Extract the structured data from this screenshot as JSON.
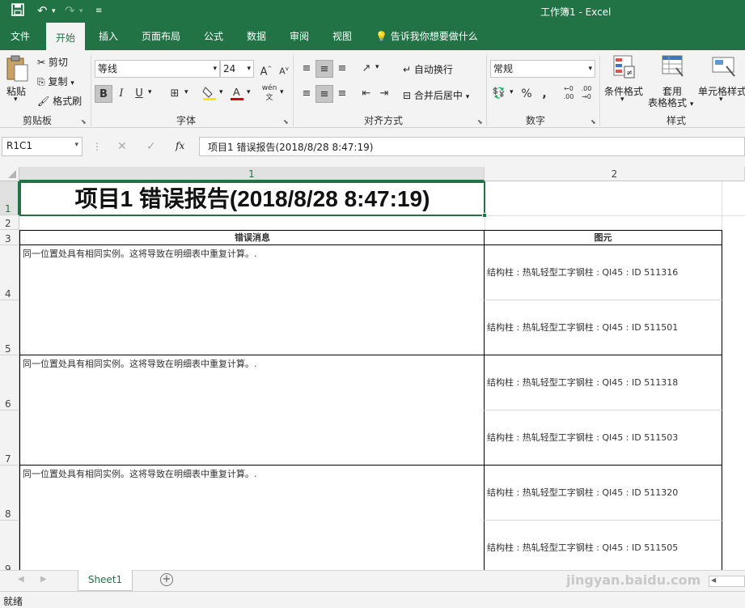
{
  "titlebar": {
    "title": "工作簿1 - Excel",
    "save_icon": "save-icon",
    "undo_icon": "undo-icon",
    "redo_icon": "redo-icon",
    "customize_icon": "customize-icon",
    "bg": "#217346"
  },
  "tabs": [
    {
      "label": "文件"
    },
    {
      "label": "开始"
    },
    {
      "label": "插入"
    },
    {
      "label": "页面布局"
    },
    {
      "label": "公式"
    },
    {
      "label": "数据"
    },
    {
      "label": "审阅"
    },
    {
      "label": "视图"
    }
  ],
  "tell_me": "告诉我你想要做什么",
  "ribbon": {
    "clipboard": {
      "paste": "粘贴",
      "cut": "剪切",
      "copy": "复制",
      "format_painter": "格式刷",
      "label": "剪贴板"
    },
    "font": {
      "name": "等线",
      "size": "24",
      "bold": "B",
      "italic": "I",
      "underline": "U",
      "phonetic": "wén",
      "label": "字体",
      "font_color": "#e00000",
      "fill_color": "#ffe600"
    },
    "alignment": {
      "wrap": "自动换行",
      "merge": "合并后居中",
      "label": "对齐方式"
    },
    "number": {
      "format": "常规",
      "percent": "%",
      "comma": ",",
      "label": "数字"
    },
    "styles": {
      "conditional": "条件格式",
      "table1": "套用",
      "table2": "表格格式",
      "cell_styles": "单元格样式",
      "label": "样式"
    }
  },
  "formula_bar": {
    "name_box": "R1C1",
    "cancel": "✕",
    "enter": "✓",
    "fx": "fx",
    "content": "项目1 错误报告(2018/8/28 8:47:19)"
  },
  "grid": {
    "col_headers": [
      "1",
      "2"
    ],
    "row_headers": [
      "1",
      "2",
      "3",
      "4",
      "5",
      "6",
      "7",
      "8",
      "9"
    ],
    "title": "项目1 错误报告(2018/8/28 8:47:19)",
    "header_col1": "错误消息",
    "header_col2": "图元",
    "messages": [
      "同一位置处具有相同实例。这将导致在明细表中重复计算。.",
      "同一位置处具有相同实例。这将导致在明细表中重复计算。.",
      "同一位置处具有相同实例。这将导致在明细表中重复计算。."
    ],
    "elements": [
      "结构柱 : 热轧轻型工字钢柱 : QI45 : ID 511316",
      "结构柱 : 热轧轻型工字钢柱 : QI45 : ID 511501",
      "结构柱 : 热轧轻型工字钢柱 : QI45 : ID 511318",
      "结构柱 : 热轧轻型工字钢柱 : QI45 : ID 511503",
      "结构柱 : 热轧轻型工字钢柱 : QI45 : ID 511320",
      "结构柱 : 热轧轻型工字钢柱 : QI45 : ID 511505"
    ]
  },
  "sheet_tabs": {
    "active": "Sheet1",
    "add": "+"
  },
  "status": "就绪",
  "watermark": "jingyan.baidu.com"
}
